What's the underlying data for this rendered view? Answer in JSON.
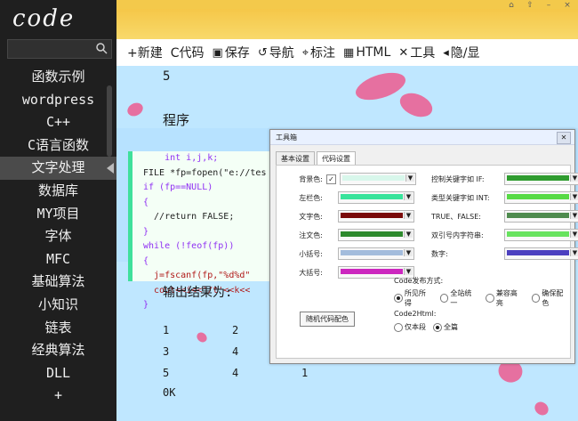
{
  "sidebar": {
    "logo": "code",
    "search_placeholder": "",
    "items": [
      {
        "label": "函数示例"
      },
      {
        "label": "wordpress"
      },
      {
        "label": "C++"
      },
      {
        "label": "C语言函数"
      },
      {
        "label": "文字处理"
      },
      {
        "label": "数据库"
      },
      {
        "label": "MY项目"
      },
      {
        "label": "字体"
      },
      {
        "label": "MFC"
      },
      {
        "label": "基础算法"
      },
      {
        "label": "小知识"
      },
      {
        "label": "链表"
      },
      {
        "label": "经典算法"
      },
      {
        "label": "DLL"
      },
      {
        "label": "+"
      }
    ],
    "active_index": 4
  },
  "toolbar": {
    "new": "+新建",
    "code": "C代码",
    "save": "保存",
    "nav": "导航",
    "mark": "标注",
    "html": "HTML",
    "tools": "工具",
    "hide": "隐/显",
    "icons": [
      "save-icon",
      "navigate-icon",
      "pin-icon",
      "html-icon",
      "tools-icon",
      "toggle-icon"
    ]
  },
  "content": {
    "number_top": "5",
    "program_heading": "程序",
    "output_heading": "输出结果为:",
    "code_lines": [
      "int i,j,k;",
      "FILE *fp=fopen(\"e://tes",
      "if (fp==NULL)",
      "{",
      "  //return FALSE;",
      "}",
      "while (!feof(fp))",
      "{",
      "  j=fscanf(fp,\"%d%d\"",
      "  cout<<i<<'/t'<<k<<",
      "}"
    ],
    "results": [
      [
        "1",
        "2"
      ],
      [
        "3",
        "4"
      ],
      [
        "5",
        "4",
        "1"
      ],
      [
        "0K"
      ]
    ]
  },
  "dialog": {
    "title": "工具箱",
    "tabs": [
      "基本设置",
      "代码设置"
    ],
    "active_tab": 1,
    "left_labels": [
      "背景色:",
      "左栏色:",
      "文字色:",
      "注文色:",
      "小括号:",
      "大括号:"
    ],
    "left_colors": [
      "#d8f7eb",
      "#38e39b",
      "#7a0a0a",
      "#2d8a2d",
      "#a3bcdc",
      "#cc27bf"
    ],
    "right_labels": [
      "控制关键字如 IF:",
      "类型关键字如 INT:",
      "TRUE、FALSE:",
      "双引号内字符串:",
      "数字:"
    ],
    "right_colors": [
      "#2f9c2f",
      "#57da45",
      "#4e8b4e",
      "#67e35e",
      "#4c40c0"
    ],
    "random_button": "随机代码配色",
    "publish_label": "Code发布方式:",
    "publish_options": [
      "所见所得",
      "全站统一",
      "兼容高亮",
      "确保配色"
    ],
    "publish_selected": 0,
    "html_label": "Code2Html:",
    "html_options": [
      "仅本段",
      "全篇"
    ],
    "html_selected": 1
  },
  "window": {
    "buttons": [
      "⌂",
      "⇧",
      "–",
      "×"
    ]
  }
}
